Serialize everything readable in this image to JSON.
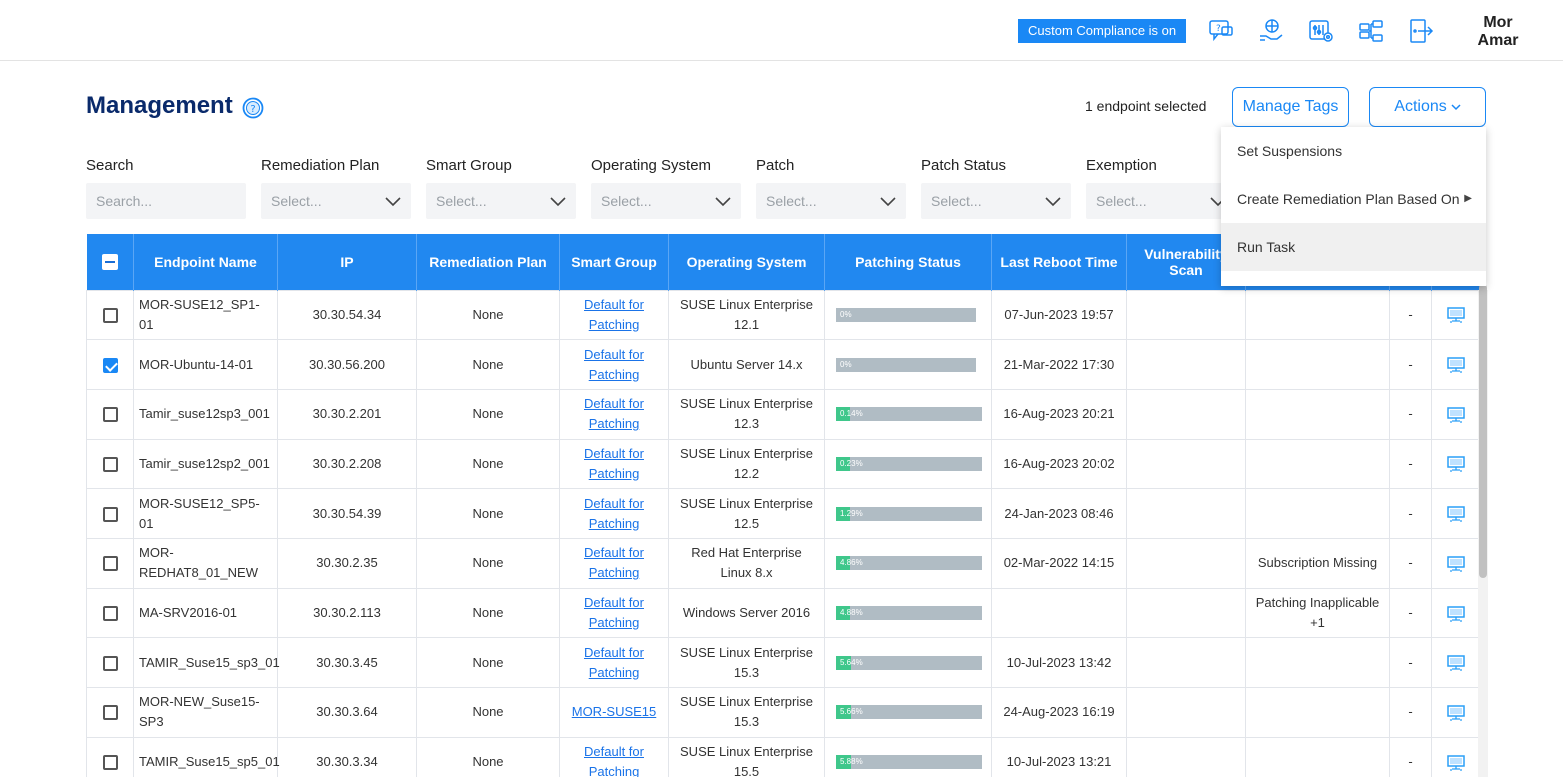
{
  "header": {
    "compliance_badge": "Custom Compliance is on",
    "icons": [
      "support-chat-icon",
      "globe-hand-icon",
      "settings-sliders-icon",
      "network-icon",
      "logout-door-icon"
    ],
    "user_first": "Mor",
    "user_last": "Amar"
  },
  "page": {
    "title": "Management",
    "selected_count": "1 endpoint selected",
    "manage_tags": "Manage Tags",
    "actions": "Actions"
  },
  "filters": [
    {
      "label": "Search",
      "placeholder": "Search..."
    },
    {
      "label": "Remediation Plan",
      "placeholder": "Select..."
    },
    {
      "label": "Smart Group",
      "placeholder": "Select..."
    },
    {
      "label": "Operating System",
      "placeholder": "Select..."
    },
    {
      "label": "Patch",
      "placeholder": "Select..."
    },
    {
      "label": "Patch Status",
      "placeholder": "Select..."
    },
    {
      "label": "Exemption",
      "placeholder": "Select..."
    }
  ],
  "menu": {
    "items": [
      "Set Suspensions",
      "Create Remediation Plan Based On",
      "Run Task"
    ]
  },
  "table": {
    "columns": [
      "Endpoint Name",
      "IP",
      "Remediation Plan",
      "Smart Group",
      "Operating System",
      "Patching Status",
      "Last Reboot Time",
      "Vulnerability Scan"
    ],
    "rows": [
      {
        "name": "MOR-SUSE12_SP1-01",
        "ip": "30.30.54.34",
        "plan": "None",
        "group": "Default for Patching",
        "os": "SUSE Linux Enterprise 12.1",
        "patch": "0%",
        "patch_frac": 0,
        "reboot": "07-Jun-2023 19:57",
        "scan": "",
        "status": "",
        "dash": "-",
        "checked": false
      },
      {
        "name": "MOR-Ubuntu-14-01",
        "ip": "30.30.56.200",
        "plan": "None",
        "group": "Default for Patching",
        "os": "Ubuntu Server 14.x",
        "patch": "0%",
        "patch_frac": 0,
        "reboot": "21-Mar-2022 17:30",
        "scan": "",
        "status": "",
        "dash": "-",
        "checked": true
      },
      {
        "name": "Tamir_suse12sp3_001",
        "ip": "30.30.2.201",
        "plan": "None",
        "group": "Default for Patching",
        "os": "SUSE Linux Enterprise 12.3",
        "patch": "0.14%",
        "patch_frac": 0.0014,
        "reboot": "16-Aug-2023 20:21",
        "scan": "",
        "status": "",
        "dash": "-",
        "checked": false
      },
      {
        "name": "Tamir_suse12sp2_001",
        "ip": "30.30.2.208",
        "plan": "None",
        "group": "Default for Patching",
        "os": "SUSE Linux Enterprise 12.2",
        "patch": "0.23%",
        "patch_frac": 0.0023,
        "reboot": "16-Aug-2023 20:02",
        "scan": "",
        "status": "",
        "dash": "-",
        "checked": false
      },
      {
        "name": "MOR-SUSE12_SP5-01",
        "ip": "30.30.54.39",
        "plan": "None",
        "group": "Default for Patching",
        "os": "SUSE Linux Enterprise 12.5",
        "patch": "1.29%",
        "patch_frac": 0.0129,
        "reboot": "24-Jan-2023 08:46",
        "scan": "",
        "status": "",
        "dash": "-",
        "checked": false
      },
      {
        "name": "MOR-REDHAT8_01_NEW",
        "ip": "30.30.2.35",
        "plan": "None",
        "group": "Default for Patching",
        "os": "Red Hat Enterprise Linux 8.x",
        "patch": "4.86%",
        "patch_frac": 0.0486,
        "reboot": "02-Mar-2022 14:15",
        "scan": "",
        "status": "Subscription Missing",
        "dash": "-",
        "checked": false
      },
      {
        "name": "MA-SRV2016-01",
        "ip": "30.30.2.113",
        "plan": "None",
        "group": "Default for Patching",
        "os": "Windows Server 2016",
        "patch": "4.88%",
        "patch_frac": 0.0488,
        "reboot": "",
        "scan": "",
        "status": "Patching Inapplicable +1",
        "dash": "-",
        "checked": false
      },
      {
        "name": "TAMIR_Suse15_sp3_01",
        "ip": "30.30.3.45",
        "plan": "None",
        "group": "Default for Patching",
        "os": "SUSE Linux Enterprise 15.3",
        "patch": "5.64%",
        "patch_frac": 0.0564,
        "reboot": "10-Jul-2023 13:42",
        "scan": "",
        "status": "",
        "dash": "-",
        "checked": false
      },
      {
        "name": "MOR-NEW_Suse15-SP3",
        "ip": "30.30.3.64",
        "plan": "None",
        "group": "MOR-SUSE15",
        "os": "SUSE Linux Enterprise 15.3",
        "patch": "5.66%",
        "patch_frac": 0.0566,
        "reboot": "24-Aug-2023 16:19",
        "scan": "",
        "status": "",
        "dash": "-",
        "checked": false
      },
      {
        "name": "TAMIR_Suse15_sp5_01",
        "ip": "30.30.3.34",
        "plan": "None",
        "group": "Default for Patching",
        "os": "SUSE Linux Enterprise 15.5",
        "patch": "5.88%",
        "patch_frac": 0.0588,
        "reboot": "10-Jul-2023 13:21",
        "scan": "",
        "status": "",
        "dash": "-",
        "checked": false
      }
    ]
  },
  "colors": {
    "primary": "#1a88f5",
    "header": "#2188f0",
    "progress_fill": "#3fc78b",
    "progress_bg": "#b0bcc4",
    "title": "#0a2a6b"
  }
}
